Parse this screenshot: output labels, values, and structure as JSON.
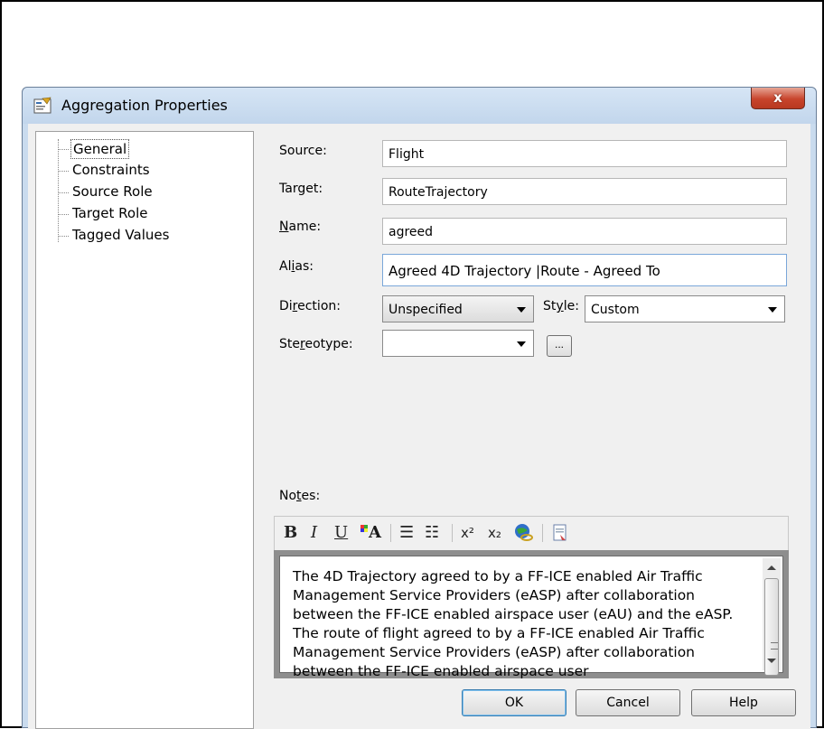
{
  "window": {
    "title": "Aggregation Properties",
    "close_label": "x"
  },
  "tree": {
    "items": [
      {
        "label": "General",
        "selected": true
      },
      {
        "label": "Constraints",
        "selected": false
      },
      {
        "label": "Source Role",
        "selected": false
      },
      {
        "label": "Target Role",
        "selected": false
      },
      {
        "label": "Tagged Values",
        "selected": false
      }
    ]
  },
  "form": {
    "source_label": "Source:",
    "source_value": "Flight",
    "target_label": "Target:",
    "target_value": "RouteTrajectory",
    "name_label_pre": "",
    "name_label_u": "N",
    "name_label_post": "ame:",
    "name_value": "agreed",
    "alias_label_pre": "Al",
    "alias_label_u": "i",
    "alias_label_post": "as:",
    "alias_value": "Agreed 4D Trajectory |Route - Agreed To",
    "direction_label_pre": "Di",
    "direction_label_u": "r",
    "direction_label_post": "ection:",
    "direction_value": "Unspecified",
    "style_label_pre": "St",
    "style_label_u": "y",
    "style_label_post": "le:",
    "style_value": "Custom",
    "stereotype_label_pre": "Ste",
    "stereotype_label_u": "r",
    "stereotype_label_post": "eotype:",
    "stereotype_value": "",
    "stereotype_button": "...",
    "notes_label_pre": "No",
    "notes_label_u": "t",
    "notes_label_post": "es:"
  },
  "toolbar": {
    "bold": "B",
    "italic": "I",
    "underline": "U",
    "font_color": "A",
    "bullets": "☰",
    "numbered": "☷",
    "superscript": "x²",
    "subscript": "x₂"
  },
  "notes": {
    "paragraphs": [
      "The 4D Trajectory agreed to by a FF-ICE enabled Air Traffic Management Service Providers (eASP) after collaboration between the FF-ICE enabled airspace user (eAU) and the eASP.",
      "The route of flight agreed to by a FF-ICE enabled Air Traffic Management Service Providers (eASP) after collaboration between the FF-ICE enabled airspace user"
    ]
  },
  "buttons": {
    "ok": "OK",
    "cancel": "Cancel",
    "help": "Help"
  }
}
